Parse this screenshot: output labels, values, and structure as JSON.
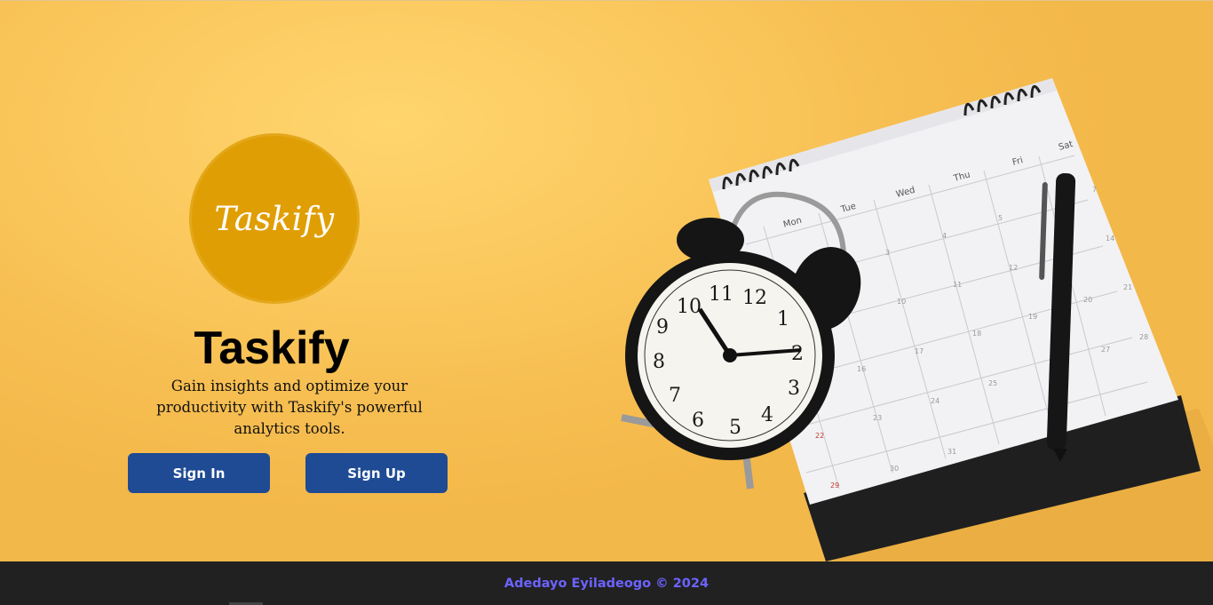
{
  "hero": {
    "logo_text": "Taskify",
    "title": "Taskify",
    "tagline": "Gain insights and optimize your productivity with Taskify's powerful analytics tools."
  },
  "buttons": {
    "sign_in": "Sign In",
    "sign_up": "Sign Up"
  },
  "footer": {
    "text": "Adedayo Eyiladeogo © 2024"
  },
  "calendar": {
    "weekdays": [
      "Mon",
      "Tue",
      "Wed",
      "Thu",
      "Fri",
      "Sat"
    ],
    "numbers": [
      "3",
      "4",
      "5",
      "7",
      "10",
      "11",
      "12",
      "14",
      "16",
      "17",
      "18",
      "19",
      "20",
      "21",
      "22",
      "23",
      "24",
      "25",
      "27",
      "28",
      "29",
      "30",
      "31"
    ]
  },
  "clock": {
    "numerals": [
      "12",
      "1",
      "2",
      "3",
      "4",
      "5",
      "6",
      "7",
      "8",
      "9",
      "10",
      "11"
    ]
  },
  "colors": {
    "background": "#f7c357",
    "logo_circle": "#e09e05",
    "button": "#1e4b93",
    "footer_bg": "#212121",
    "footer_text": "#6c63ff"
  }
}
